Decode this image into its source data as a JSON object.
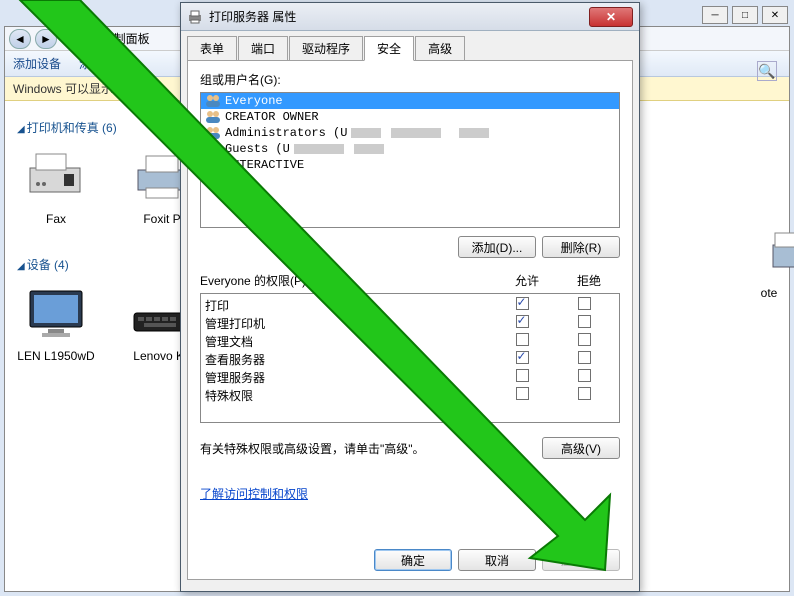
{
  "sys": {
    "min": "─",
    "max": "□",
    "close": "✕"
  },
  "explorer": {
    "breadcrumb_icon": "🖨",
    "breadcrumb": "控制面板",
    "toolbar": {
      "add_device": "添加设备",
      "add_printer": "添加打印机"
    },
    "yellowbar": "Windows 可以显示增强型设",
    "sections": {
      "printers": {
        "title": "打印机和传真 (6)",
        "items": [
          {
            "label": "Fax"
          },
          {
            "label": "Foxit P"
          }
        ]
      },
      "devices": {
        "title": "设备 (4)",
        "items": [
          {
            "label": "LEN L1950wD"
          },
          {
            "label": "Lenovo Ke"
          }
        ]
      },
      "right_item": "ote"
    }
  },
  "dialog": {
    "title": "打印服务器 属性",
    "tabs": [
      "表单",
      "端口",
      "驱动程序",
      "安全",
      "高级"
    ],
    "active_tab": 3,
    "group_label": "组或用户名(G):",
    "users": [
      {
        "name": "Everyone",
        "selected": true
      },
      {
        "name": "CREATOR OWNER"
      },
      {
        "name": "Administrators (U",
        "redacted": true
      },
      {
        "name": "Guests (U",
        "redacted": true
      },
      {
        "name": "INTERACTIVE"
      }
    ],
    "btn_add": "添加(D)...",
    "btn_remove": "删除(R)",
    "perm_label": "Everyone 的权限(P)",
    "perm_cols": {
      "allow": "允许",
      "deny": "拒绝"
    },
    "permissions": [
      {
        "name": "打印",
        "allow": true,
        "deny": false
      },
      {
        "name": "管理打印机",
        "allow": true,
        "deny": false
      },
      {
        "name": "管理文档",
        "allow": false,
        "deny": false
      },
      {
        "name": "查看服务器",
        "allow": true,
        "deny": false
      },
      {
        "name": "管理服务器",
        "allow": false,
        "deny": false
      },
      {
        "name": "特殊权限",
        "allow": false,
        "deny": false
      }
    ],
    "adv_text": "有关特殊权限或高级设置，请单击\"高级\"。",
    "btn_advanced": "高级(V)",
    "link": "了解访问控制和权限",
    "btn_ok": "确定",
    "btn_cancel": "取消",
    "btn_apply": "应用(A)"
  }
}
